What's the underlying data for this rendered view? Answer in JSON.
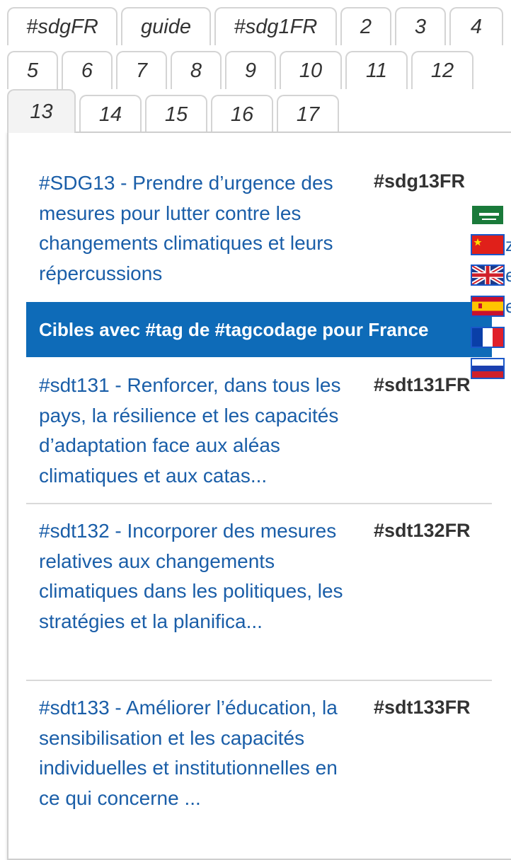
{
  "tabs": [
    {
      "label": "#sdgFR"
    },
    {
      "label": "guide"
    },
    {
      "label": "#sdg1FR"
    },
    {
      "label": "2"
    },
    {
      "label": "3"
    },
    {
      "label": "4"
    },
    {
      "label": "5"
    },
    {
      "label": "6"
    },
    {
      "label": "7"
    },
    {
      "label": "8"
    },
    {
      "label": "9"
    },
    {
      "label": "10"
    },
    {
      "label": "11"
    },
    {
      "label": "12"
    },
    {
      "label": "13"
    },
    {
      "label": "14"
    },
    {
      "label": "15"
    },
    {
      "label": "16"
    },
    {
      "label": "17"
    }
  ],
  "active_tab": "13",
  "goal": {
    "link_text": "#SDG13 - Prendre d’urgence des mesures pour lutter contre les changements climatiques et leurs répercussions",
    "tag": "#sdg13FR"
  },
  "targets_header": "Cibles avec #tag de #tagcodage pour France",
  "targets": [
    {
      "link_text": "#sdt131 - Renforcer, dans tous les pays, la résilience et les capacités d’adaptation face aux aléas climatiques et aux catas...",
      "tag": "#sdt131FR"
    },
    {
      "link_text": "#sdt132 - Incorporer des mesures relatives aux changements climatiques dans les politiques, les stratégies et la planifica...",
      "tag": "#sdt132FR"
    },
    {
      "link_text": "#sdt133 - Améliorer l’éducation, la sensibilisation et les capacités individuelles et institutionnelles en ce qui concerne ...",
      "tag": "#sdt133FR"
    }
  ],
  "languages": [
    {
      "flag": "saudi-arabia-flag",
      "code": ""
    },
    {
      "flag": "china-flag",
      "code": "z"
    },
    {
      "flag": "uk-flag",
      "code": "e"
    },
    {
      "flag": "spain-flag",
      "code": "e"
    },
    {
      "flag": "france-flag",
      "code": ""
    },
    {
      "flag": "russia-flag",
      "code": ""
    }
  ],
  "colors": {
    "link": "#1a5ea8",
    "band": "#0e6bb8",
    "tag": "#333333"
  }
}
